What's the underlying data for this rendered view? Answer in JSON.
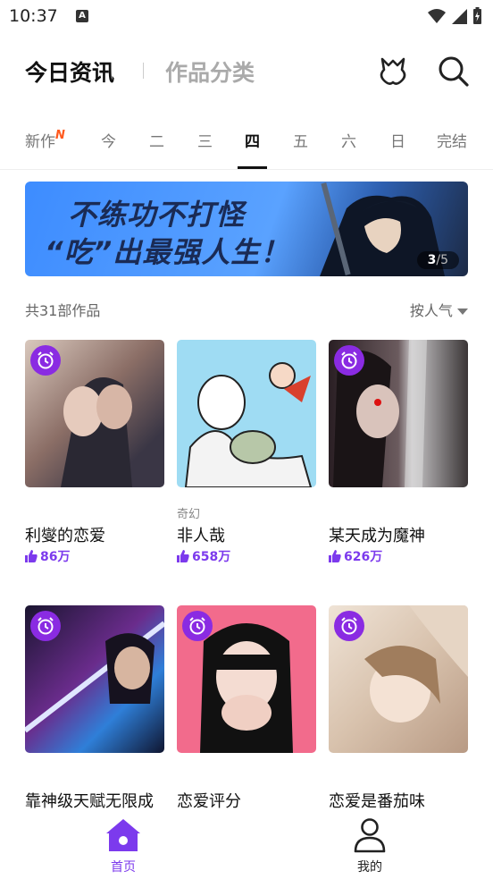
{
  "status": {
    "time": "10:37",
    "notif_icon_label": "A"
  },
  "header": {
    "tab_active": "今日资讯",
    "tab_inactive": "作品分类"
  },
  "days": [
    "今",
    "二",
    "三",
    "四",
    "五",
    "六",
    "日",
    "完结"
  ],
  "new_tab": {
    "label": "新作",
    "badge": "N"
  },
  "active_day": "四",
  "banner": {
    "line1": "不练功不打怪",
    "line2": "“吃”出最强人生！",
    "current": "3",
    "sep": "/",
    "total": "5"
  },
  "list": {
    "count_text": "共31部作品",
    "sort_label": "按人气"
  },
  "comics": [
    {
      "title": "利燮的恋爱",
      "genre": "",
      "likes": "86万"
    },
    {
      "title": "非人哉",
      "genre": "奇幻",
      "likes": "658万"
    },
    {
      "title": "某天成为魔神",
      "genre": "",
      "likes": "626万"
    },
    {
      "title": "靠神级天赋无限成",
      "genre": "",
      "likes": ""
    },
    {
      "title": "恋爱评分",
      "genre": "",
      "likes": ""
    },
    {
      "title": "恋爱是番茄味",
      "genre": "",
      "likes": ""
    }
  ],
  "nav": {
    "home": "首页",
    "me": "我的"
  },
  "colors": {
    "accent": "#7c3aed",
    "new_badge": "#ff5a1f",
    "alarm_bg": "#8a2be2"
  }
}
